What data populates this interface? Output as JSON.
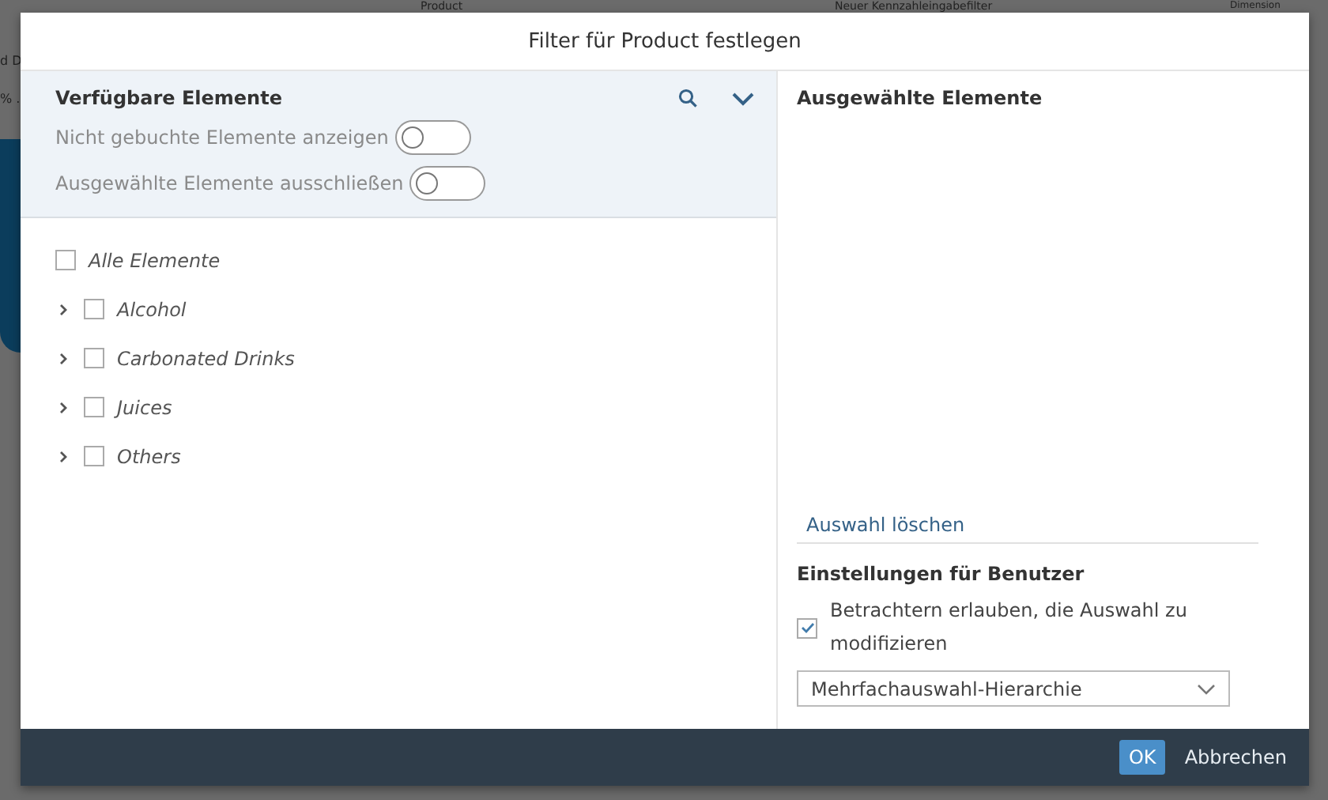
{
  "background": {
    "texts": [
      "Product",
      "Neuer Kennzahleingabefilter",
      "Dimension",
      "d D",
      "% ."
    ]
  },
  "dialog": {
    "title": "Filter für Product festlegen",
    "available": {
      "heading": "Verfügbare Elemente",
      "toggles": [
        {
          "label": "Nicht gebuchte Elemente anzeigen",
          "on": false
        },
        {
          "label": "Ausgewählte Elemente ausschließen",
          "on": false
        }
      ],
      "all": {
        "label": "Alle Elemente",
        "checked": false
      },
      "items": [
        {
          "label": "Alcohol",
          "checked": false,
          "expanded": false
        },
        {
          "label": "Carbonated Drinks",
          "checked": false,
          "expanded": false
        },
        {
          "label": "Juices",
          "checked": false,
          "expanded": false
        },
        {
          "label": "Others",
          "checked": false,
          "expanded": false
        }
      ]
    },
    "selected": {
      "heading": "Ausgewählte Elemente",
      "clear_link": "Auswahl löschen",
      "settings_heading": "Einstellungen für Benutzer",
      "allow": {
        "label": "Betrachtern erlauben, die Auswahl zu modifizieren",
        "checked": true
      },
      "mode": {
        "value": "Mehrfachauswahl-Hierarchie"
      }
    },
    "buttons": [
      {
        "label": "OK",
        "kind": "primary"
      },
      {
        "label": "Abbrechen",
        "kind": "secondary"
      }
    ]
  }
}
